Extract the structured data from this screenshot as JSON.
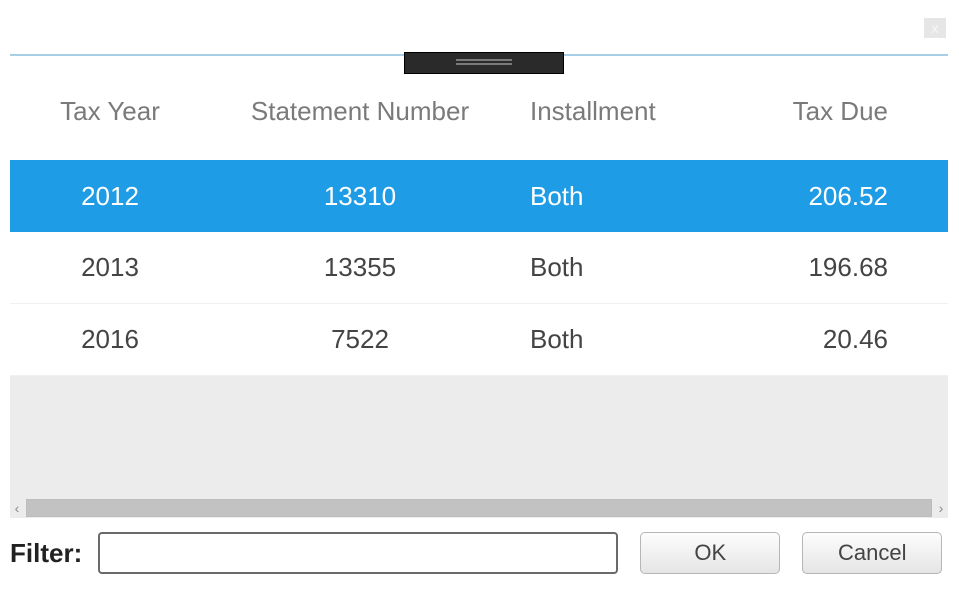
{
  "close_glyph": "x",
  "columns": {
    "tax_year": "Tax Year",
    "statement_number": "Statement Number",
    "installment": "Installment",
    "tax_due": "Tax Due"
  },
  "rows": [
    {
      "tax_year": "2012",
      "statement_number": "13310",
      "installment": "Both",
      "tax_due": "206.52",
      "selected": true
    },
    {
      "tax_year": "2013",
      "statement_number": "13355",
      "installment": "Both",
      "tax_due": "196.68",
      "selected": false
    },
    {
      "tax_year": "2016",
      "statement_number": "7522",
      "installment": "Both",
      "tax_due": "20.46",
      "selected": false
    }
  ],
  "scroll": {
    "left_glyph": "‹",
    "right_glyph": "›"
  },
  "footer": {
    "filter_label": "Filter:",
    "filter_value": "",
    "ok_label": "OK",
    "cancel_label": "Cancel"
  }
}
